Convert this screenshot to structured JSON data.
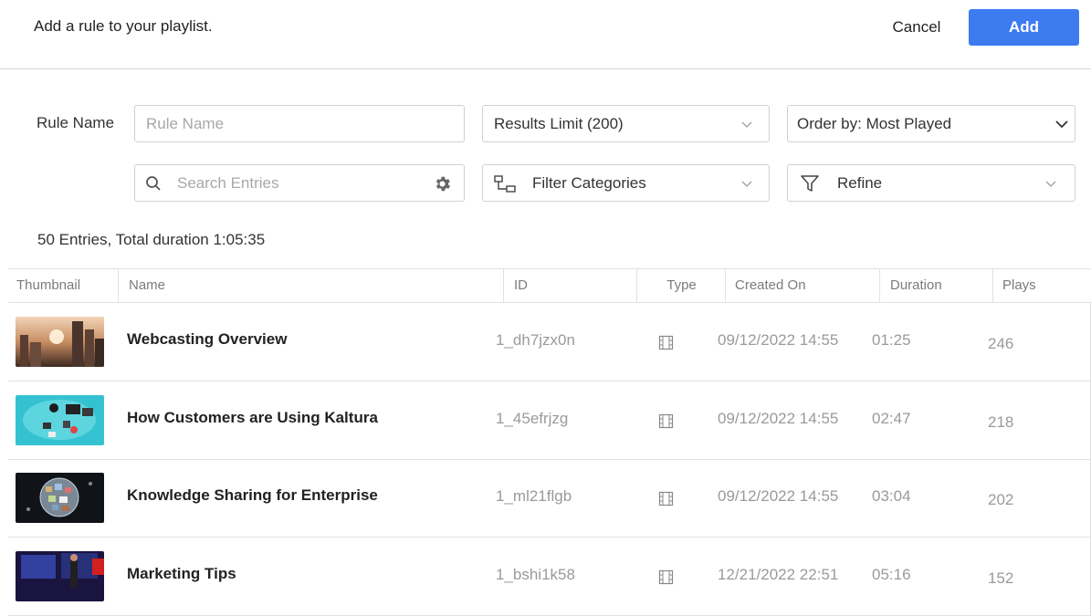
{
  "header": {
    "title": "Add a rule to your playlist.",
    "cancel_label": "Cancel",
    "add_label": "Add"
  },
  "form": {
    "rule_name_label": "Rule Name",
    "rule_name_placeholder": "Rule Name",
    "rule_name_value": "",
    "results_limit": "Results Limit (200)",
    "order_by": "Order by: Most Played",
    "search_placeholder": "Search Entries",
    "filter_categories": "Filter Categories",
    "refine": "Refine"
  },
  "icons": {
    "search": "search-icon",
    "settings": "gear-icon",
    "categories": "category-tree-icon",
    "refine": "funnel-icon",
    "dropdown": "chevron-down-icon",
    "type": "video-icon"
  },
  "summary": "50 Entries, Total duration 1:05:35",
  "table": {
    "columns": [
      "Thumbnail",
      "Name",
      "ID",
      "Type",
      "Created On",
      "Duration",
      "Plays"
    ],
    "rows": [
      {
        "name": "Webcasting Overview",
        "id": "1_dh7jzx0n",
        "type": "video",
        "created": "09/12/2022 14:55",
        "duration": "01:25",
        "plays": "246"
      },
      {
        "name": "How Customers are Using Kaltura",
        "id": "1_45efrjzg",
        "type": "video",
        "created": "09/12/2022 14:55",
        "duration": "02:47",
        "plays": "218"
      },
      {
        "name": "Knowledge Sharing for Enterprise",
        "id": "1_ml21flgb",
        "type": "video",
        "created": "09/12/2022 14:55",
        "duration": "03:04",
        "plays": "202"
      },
      {
        "name": "Marketing Tips",
        "id": "1_bshi1k58",
        "type": "video",
        "created": "12/21/2022 22:51",
        "duration": "05:16",
        "plays": "152"
      }
    ]
  },
  "colors": {
    "accent": "#3d7bf0",
    "border": "#d0d0d0",
    "muted_text": "#9a9a9a"
  }
}
